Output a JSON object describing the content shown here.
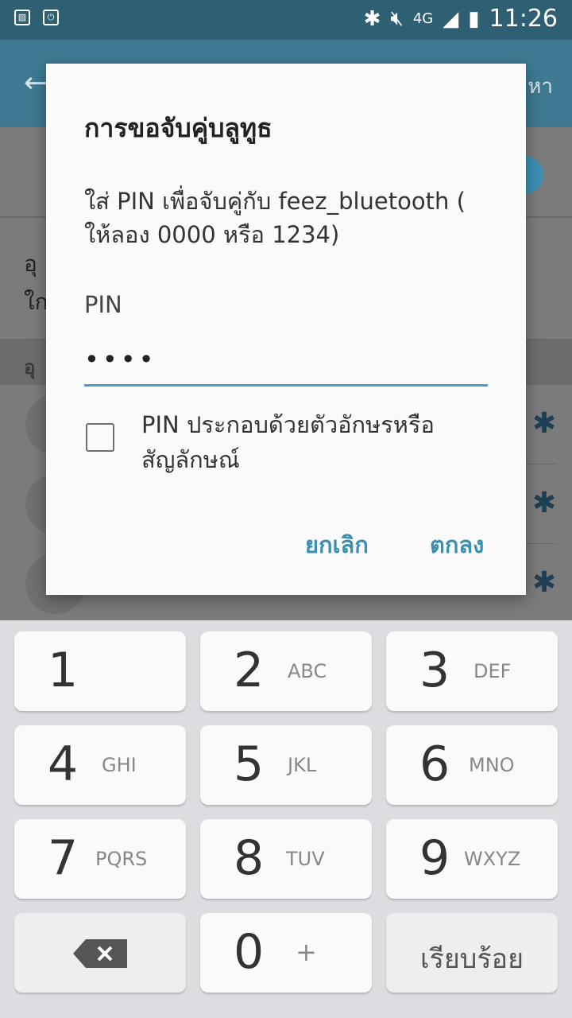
{
  "status_bar": {
    "left_icons": [
      "gallery-icon",
      "screen-mirror-icon"
    ],
    "network": "4G",
    "time": "11:26"
  },
  "app_bar": {
    "right_text": "หา"
  },
  "background_text": {
    "line1_prefix": "อุ",
    "line2_prefix": "ใก",
    "section_label": "อุ"
  },
  "dialog": {
    "title": "การขอจับคู่บลูทูธ",
    "message": "ใส่ PIN เพื่อจับคู่กับ feez_bluetooth ( ให้ลอง 0000 หรือ 1234)",
    "pin_label": "PIN",
    "pin_value": "••••",
    "checkbox_label": "PIN ประกอบด้วยตัวอักษรหรือสัญลักษณ์",
    "checkbox_checked": false,
    "cancel_label": "ยกเลิก",
    "ok_label": "ตกลง",
    "accent": "#3c8fb3"
  },
  "keyboard": {
    "keys": [
      {
        "num": "1",
        "letters": ""
      },
      {
        "num": "2",
        "letters": "ABC"
      },
      {
        "num": "3",
        "letters": "DEF"
      },
      {
        "num": "4",
        "letters": "GHI"
      },
      {
        "num": "5",
        "letters": "JKL"
      },
      {
        "num": "6",
        "letters": "MNO"
      },
      {
        "num": "7",
        "letters": "PQRS"
      },
      {
        "num": "8",
        "letters": "TUV"
      },
      {
        "num": "9",
        "letters": "WXYZ"
      },
      {
        "num": "0",
        "letters": "+"
      }
    ],
    "done_label": "เรียบร้อย"
  }
}
